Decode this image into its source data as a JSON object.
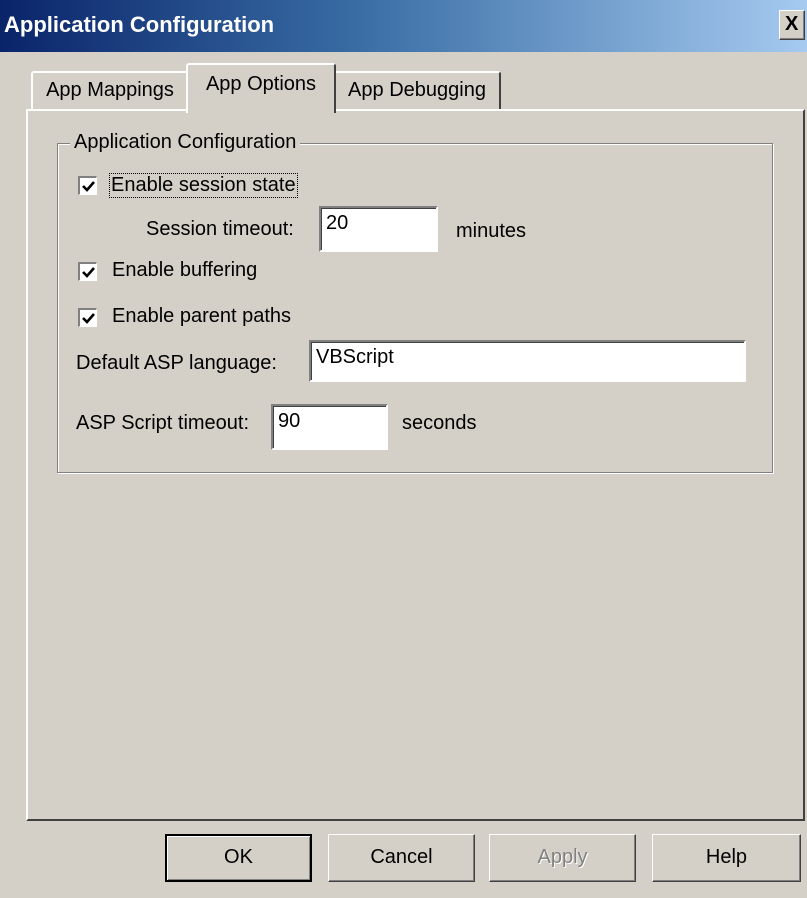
{
  "window": {
    "title": "Application Configuration",
    "close_label": "X"
  },
  "tabs": [
    {
      "label": "App Mappings",
      "active": false
    },
    {
      "label": "App Options",
      "active": true
    },
    {
      "label": "App Debugging",
      "active": false
    }
  ],
  "group": {
    "legend": "Application Configuration",
    "enable_session_state": {
      "label": "Enable session state",
      "checked": true
    },
    "session_timeout": {
      "label": "Session timeout:",
      "value": "20",
      "unit": "minutes"
    },
    "enable_buffering": {
      "label": "Enable buffering",
      "checked": true
    },
    "enable_parent_paths": {
      "label": "Enable parent paths",
      "checked": true
    },
    "default_language": {
      "label": "Default ASP language:",
      "value": "VBScript"
    },
    "script_timeout": {
      "label": "ASP Script timeout:",
      "value": "90",
      "unit": "seconds"
    }
  },
  "buttons": {
    "ok": "OK",
    "cancel": "Cancel",
    "apply": "Apply",
    "help": "Help"
  },
  "colors": {
    "title_start": "#0a246a",
    "title_end": "#a6caf0",
    "face": "#d4d0c8"
  }
}
